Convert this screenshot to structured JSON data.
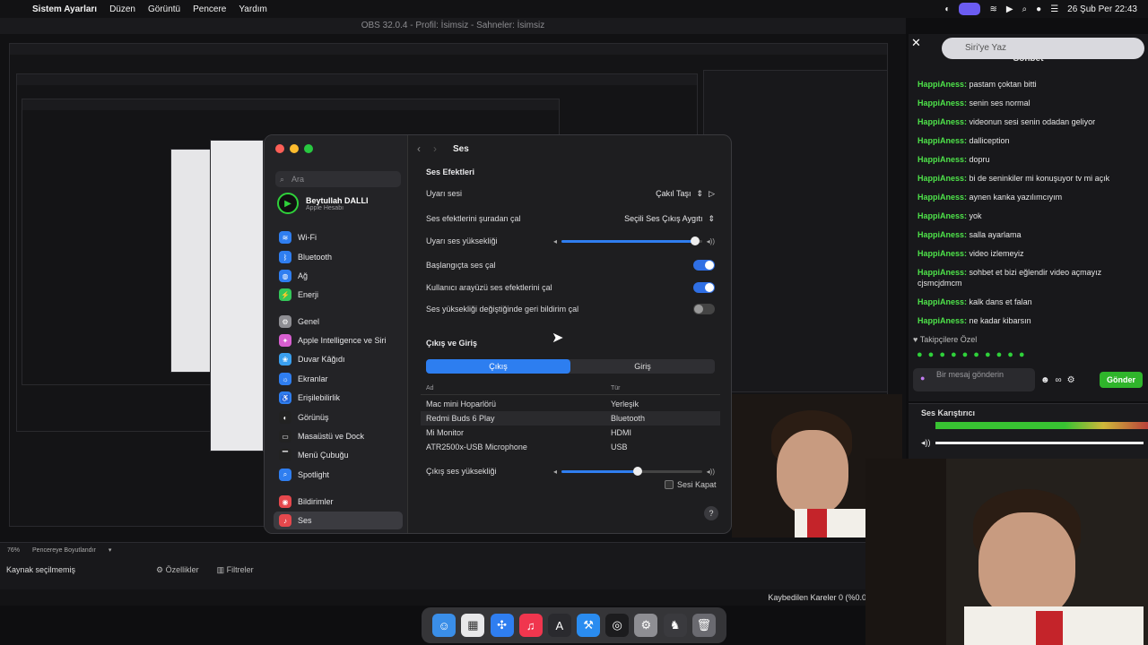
{
  "menubar": {
    "app": "Sistem Ayarları",
    "items": [
      "Düzen",
      "Görüntü",
      "Pencere",
      "Yardım"
    ],
    "clock": "26 Şub Per  22:43"
  },
  "obs": {
    "title": "OBS 32.0.4 - Profil: İsimsiz - Sahneler: İsimsiz",
    "zoom": "76%",
    "fit_label": "Pencereye Boyutlandır",
    "no_source": "Kaynak seçilmemiş",
    "properties": "Özellikler",
    "filters": "Filtreler",
    "dropped_frames": "Kaybedilen Kareler 0 (%0.0"
  },
  "settings": {
    "search_placeholder": "Ara",
    "user_name": "Beytullah DALLI",
    "user_sub": "Apple Hesabı",
    "sidebar": [
      {
        "label": "Wi-Fi",
        "color": "#2f7ef0",
        "icon": "≋"
      },
      {
        "label": "Bluetooth",
        "color": "#2f7ef0",
        "icon": "ᛒ"
      },
      {
        "label": "Ağ",
        "color": "#2f7ef0",
        "icon": "◍"
      },
      {
        "label": "Enerji",
        "color": "#34c759",
        "icon": "⚡"
      },
      {
        "label": "Genel",
        "color": "#8e8e93",
        "icon": "⚙"
      },
      {
        "label": "Apple Intelligence ve Siri",
        "color": "#d85fd0",
        "icon": "✦"
      },
      {
        "label": "Duvar Kâğıdı",
        "color": "#3aa0f0",
        "icon": "❀"
      },
      {
        "label": "Ekranlar",
        "color": "#2f7ef0",
        "icon": "☼"
      },
      {
        "label": "Erişilebilirlik",
        "color": "#2f7ef0",
        "icon": "♿"
      },
      {
        "label": "Görünüş",
        "color": "#222",
        "icon": "◐"
      },
      {
        "label": "Masaüstü ve Dock",
        "color": "#222",
        "icon": "▭"
      },
      {
        "label": "Menü Çubuğu",
        "color": "#222",
        "icon": "▔"
      },
      {
        "label": "Spotlight",
        "color": "#2f7ef0",
        "icon": "⌕"
      },
      {
        "label": "Bildirimler",
        "color": "#e5484d",
        "icon": "◉"
      },
      {
        "label": "Ses",
        "color": "#e5484d",
        "icon": "♪"
      }
    ],
    "page_title": "Ses",
    "effects_header": "Ses Efektleri",
    "alert_sound_label": "Uyarı sesi",
    "alert_sound_value": "Çakıl Taşı",
    "play_through_label": "Ses efektlerini şuradan çal",
    "play_through_value": "Seçili Ses Çıkış Aygıtı",
    "alert_volume_label": "Uyarı ses yüksekliği",
    "alert_volume": 0.95,
    "startup_label": "Başlangıçta ses çal",
    "ui_effects_label": "Kullanıcı arayüzü ses efektlerini çal",
    "feedback_label": "Ses yüksekliği değiştiğinde geri bildirim çal",
    "io_header": "Çıkış ve Giriş",
    "tab_output": "Çıkış",
    "tab_input": "Giriş",
    "col_name": "Ad",
    "col_type": "Tür",
    "devices": [
      {
        "name": "Mac mini Hoparlörü",
        "type": "Yerleşik"
      },
      {
        "name": "Redmi Buds 6 Play",
        "type": "Bluetooth"
      },
      {
        "name": "Mi Monitor",
        "type": "HDMI"
      },
      {
        "name": "ATR2500x-USB Microphone",
        "type": "USB"
      }
    ],
    "output_volume_label": "Çıkış ses yüksekliği",
    "output_volume": 0.54,
    "mute_label": "Sesi Kapat"
  },
  "chat": {
    "siri": "Siri'ye Yaz",
    "header": "Sohbet",
    "messages": [
      {
        "user": "HappiAness:",
        "text": "pastam çoktan bitti"
      },
      {
        "user": "HappiAness:",
        "text": "senin ses normal"
      },
      {
        "user": "HappiAness:",
        "text": "videonun sesi senin odadan geliyor"
      },
      {
        "user": "HappiAness:",
        "text": "dalliception"
      },
      {
        "user": "HappiAness:",
        "text": "dopru"
      },
      {
        "user": "HappiAness:",
        "text": "bi de seninkiler mi konuşuyor tv mi açık"
      },
      {
        "user": "HappiAness:",
        "text": "aynen kanka yazılımcıyım"
      },
      {
        "user": "HappiAness:",
        "text": "yok"
      },
      {
        "user": "HappiAness:",
        "text": "salla ayarlama"
      },
      {
        "user": "HappiAness:",
        "text": "video izlemeyiz"
      },
      {
        "user": "HappiAness:",
        "text": "sohbet et bizi eğlendir video açmayız cjsmcjdmcm"
      },
      {
        "user": "HappiAness:",
        "text": "kalk dans et falan"
      },
      {
        "user": "HappiAness:",
        "text": "ne kadar kibarsın"
      }
    ],
    "followers": "Takipçilere Özel",
    "input_placeholder": "Bir mesaj gönderin",
    "send": "Gönder",
    "mixer_title": "Ses Karıştırıcı"
  }
}
